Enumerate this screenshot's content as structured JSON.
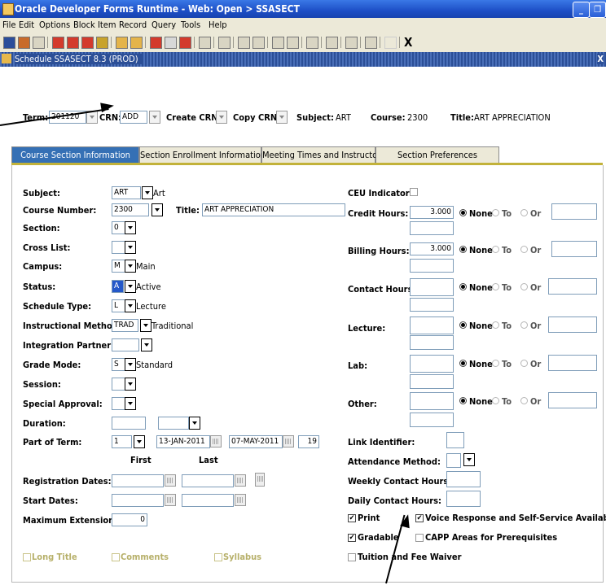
{
  "window": {
    "title": "Oracle Developer Forms Runtime - Web:  Open > SSASECT",
    "controls": [
      "_",
      "❐",
      "X"
    ]
  },
  "menu": [
    "File",
    "Edit",
    "Options",
    "Block",
    "Item",
    "Record",
    "Query",
    "Tools",
    "Help"
  ],
  "toolbar": {
    "exit_label": "X"
  },
  "form": {
    "title": "Schedule  SSASECT  8.3  (PROD)",
    "close_glyph": "X"
  },
  "key_block": {
    "term_label": "Term:",
    "term_value": "201120",
    "crn_label": "CRN:",
    "crn_value": "ADD",
    "create_crn_label": "Create CRN:",
    "copy_crn_label": "Copy CRN:",
    "subject_label": "Subject:",
    "subject_value": "ART",
    "course_label": "Course:",
    "course_value": "2300",
    "title_label": "Title:",
    "title_value": "ART APPRECIATION"
  },
  "tabs": [
    "Course Section Information",
    "Section Enrollment Information",
    "Meeting Times and Instructor",
    "Section Preferences"
  ],
  "left": {
    "subject": {
      "label": "Subject:",
      "value": "ART",
      "desc": "Art"
    },
    "course_number": {
      "label": "Course Number:",
      "value": "2300",
      "title_label": "Title:",
      "title_value": "ART APPRECIATION"
    },
    "section": {
      "label": "Section:",
      "value": "0"
    },
    "cross_list": {
      "label": "Cross List:",
      "value": ""
    },
    "campus": {
      "label": "Campus:",
      "value": "M",
      "desc": "Main"
    },
    "status": {
      "label": "Status:",
      "value": "A",
      "desc": "Active"
    },
    "schedule_type": {
      "label": "Schedule Type:",
      "value": "L",
      "desc": "Lecture"
    },
    "instructional_method": {
      "label": "Instructional Method:",
      "value": "TRAD",
      "desc": "Traditional"
    },
    "integration_partner": {
      "label": "Integration Partner:",
      "value": ""
    },
    "grade_mode": {
      "label": "Grade Mode:",
      "value": "S",
      "desc": "Standard"
    },
    "session": {
      "label": "Session:",
      "value": ""
    },
    "special_approval": {
      "label": "Special Approval:",
      "value": ""
    },
    "duration": {
      "label": "Duration:",
      "value": ""
    },
    "part_of_term": {
      "label": "Part of Term:",
      "value": "1",
      "start": "13-JAN-2011",
      "end": "07-MAY-2011",
      "weeks": "19"
    },
    "first_label": "First",
    "last_label": "Last",
    "registration_dates": {
      "label": "Registration Dates:"
    },
    "start_dates": {
      "label": "Start Dates:"
    },
    "maximum_extensions": {
      "label": "Maximum Extensions:",
      "value": "0"
    }
  },
  "right": {
    "ceu_indicator": {
      "label": "CEU Indicator:"
    },
    "credit_hours": {
      "label": "Credit Hours:",
      "value": "3.000"
    },
    "billing_hours": {
      "label": "Billing Hours:",
      "value": "3.000"
    },
    "contact_hours": {
      "label": "Contact Hours:",
      "value": ""
    },
    "lecture": {
      "label": "Lecture:",
      "value": ""
    },
    "lab": {
      "label": "Lab:",
      "value": ""
    },
    "other": {
      "label": "Other:",
      "value": ""
    },
    "radio_none": "None",
    "radio_to": "To",
    "radio_or": "Or",
    "link_identifier": {
      "label": "Link Identifier:"
    },
    "attendance_method": {
      "label": "Attendance Method:"
    },
    "weekly_contact_hours": {
      "label": "Weekly Contact Hours:"
    },
    "daily_contact_hours": {
      "label": "Daily Contact  Hours:"
    }
  },
  "checkboxes": {
    "print": {
      "label": "Print",
      "checked": true
    },
    "voice_response": {
      "label": "Voice Response and Self-Service Available",
      "checked": true
    },
    "gradable": {
      "label": "Gradable",
      "checked": true
    },
    "capp": {
      "label": "CAPP Areas for Prerequisites",
      "checked": false
    },
    "tuition": {
      "label": "Tuition and  Fee Waiver",
      "checked": false
    },
    "long_title": {
      "label": "Long Title",
      "checked": false
    },
    "comments": {
      "label": "Comments",
      "checked": false
    },
    "syllabus": {
      "label": "Syllabus",
      "checked": false
    }
  }
}
